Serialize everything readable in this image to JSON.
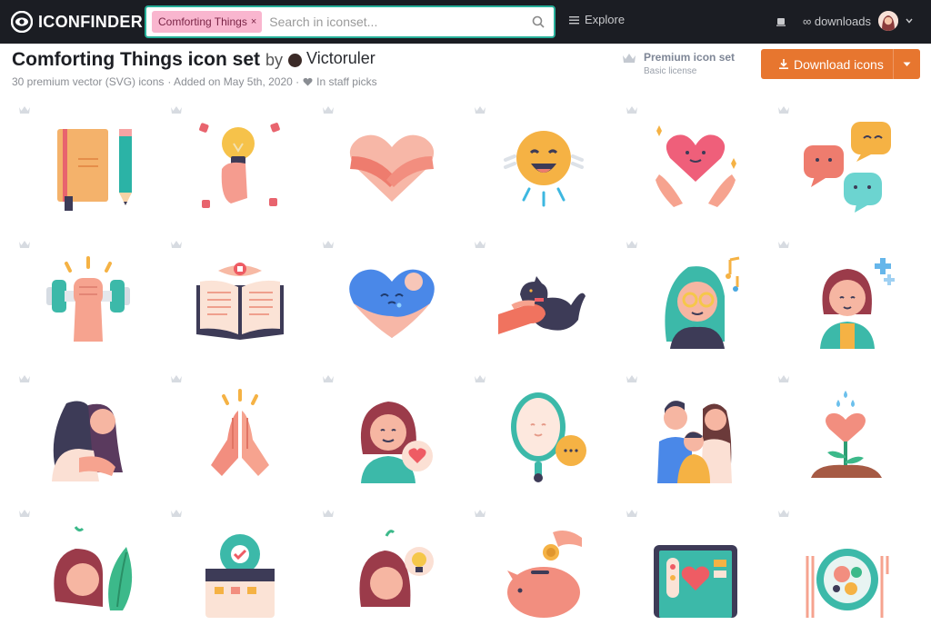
{
  "app": {
    "brand": "ICONFINDER"
  },
  "nav": {
    "search_chip": "Comforting Things",
    "search_placeholder": "Search in iconset...",
    "explore": "Explore",
    "downloads": "∞ downloads"
  },
  "iconset": {
    "title": "Comforting Things icon set",
    "by": "by",
    "author": "Victoruler",
    "meta_count": "30 premium vector (SVG) icons",
    "meta_added": "· Added on May 5th, 2020 ·",
    "meta_staff": "In staff picks",
    "premium_title": "Premium icon set",
    "premium_sub": "Basic license",
    "download_label": "Download icons"
  },
  "colors": {
    "nav_bg": "#1b1d23",
    "search_border": "#27b09a",
    "chip_bg": "#f9b6cf",
    "download_bg": "#e7762f"
  },
  "icons": [
    {
      "name": "notebook-pencil-icon"
    },
    {
      "name": "lightbulb-hand-icon"
    },
    {
      "name": "heart-hug-icon"
    },
    {
      "name": "happy-sun-icon"
    },
    {
      "name": "heart-hands-icon"
    },
    {
      "name": "chat-bubbles-icon"
    },
    {
      "name": "dumbbell-fist-icon"
    },
    {
      "name": "open-book-icon"
    },
    {
      "name": "sad-heart-icon"
    },
    {
      "name": "petting-cat-icon"
    },
    {
      "name": "music-girl-icon"
    },
    {
      "name": "healthy-woman-icon"
    },
    {
      "name": "hugging-couple-icon"
    },
    {
      "name": "praying-hands-icon"
    },
    {
      "name": "woman-heart-bubble-icon"
    },
    {
      "name": "mirror-icon"
    },
    {
      "name": "family-icon"
    },
    {
      "name": "growing-heart-plant-icon"
    },
    {
      "name": "woman-leaf-icon"
    },
    {
      "name": "calendar-check-icon"
    },
    {
      "name": "woman-idea-icon"
    },
    {
      "name": "piggy-bank-icon"
    },
    {
      "name": "tablet-heart-icon"
    },
    {
      "name": "healthy-food-icon"
    }
  ]
}
